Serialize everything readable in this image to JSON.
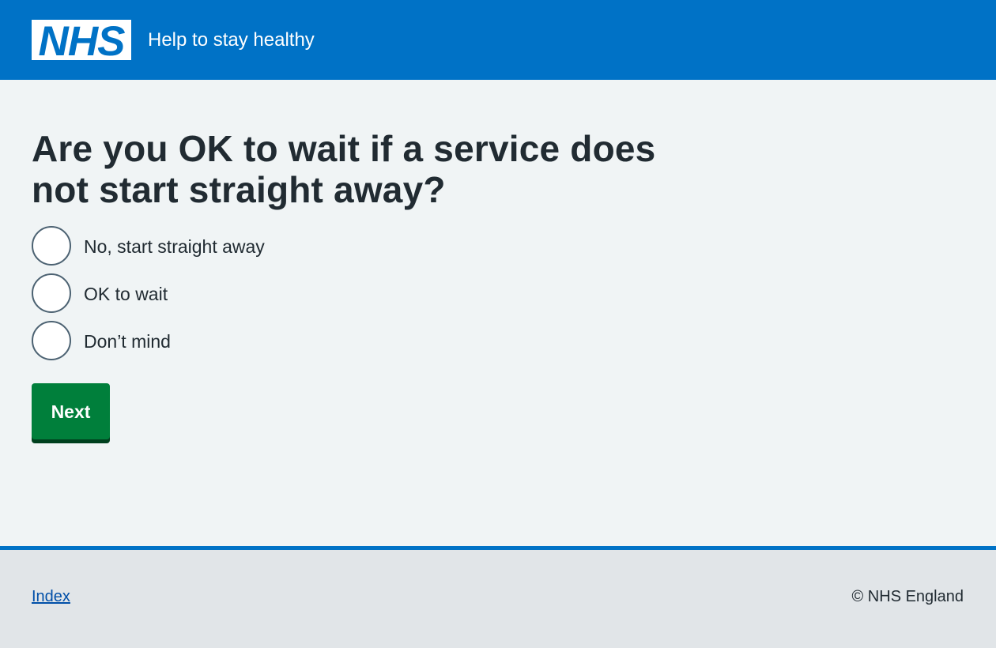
{
  "header": {
    "logo_text": "NHS",
    "service_name": "Help to stay healthy"
  },
  "main": {
    "question": "Are you OK to wait if a service does not start straight away?",
    "options": [
      {
        "label": "No, start straight away"
      },
      {
        "label": "OK to wait"
      },
      {
        "label": "Don’t mind"
      }
    ],
    "next_label": "Next"
  },
  "footer": {
    "index_link": "Index",
    "copyright": "© NHS England"
  },
  "colors": {
    "header_blue": "#0072c6",
    "button_green": "#007f3b",
    "background": "#f0f4f5",
    "footer_background": "#e1e5e8"
  }
}
